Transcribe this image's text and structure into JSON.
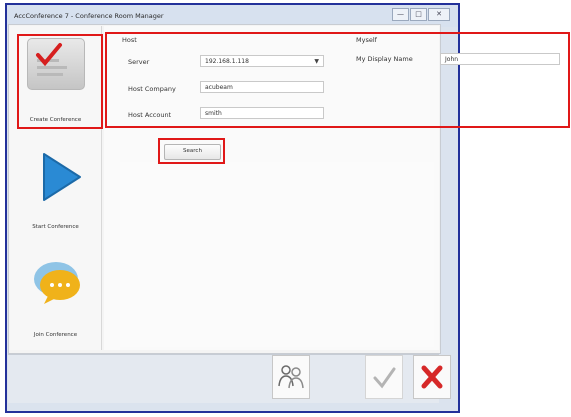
{
  "window": {
    "title": "AccConference 7 - Conference Room Manager",
    "controls": [
      "—",
      "□",
      "✕"
    ]
  },
  "sidebar": {
    "items": [
      {
        "label": "Create Conference",
        "icon": "create-conference-icon"
      },
      {
        "label": "Start Conference",
        "icon": "play-icon"
      },
      {
        "label": "Join Conference",
        "icon": "chat-bubble-icon"
      }
    ]
  },
  "host": {
    "section_label": "Host",
    "server": {
      "label": "Server",
      "value": "192.168.1.118"
    },
    "company": {
      "label": "Host Company",
      "value": "acubeam"
    },
    "account": {
      "label": "Host Account",
      "value": "smith"
    }
  },
  "myself": {
    "section_label": "Myself",
    "display_name": {
      "label": "My Display Name",
      "value": "John"
    }
  },
  "search_button": {
    "label": "Search"
  },
  "bottom": {
    "icons": [
      "users-icon",
      "check-icon",
      "close-icon"
    ]
  },
  "colors": {
    "highlight": "#e01818",
    "window_border": "#23319a",
    "play": "#2a8ad4",
    "chat": "#f0b21a",
    "close": "#d62828"
  }
}
